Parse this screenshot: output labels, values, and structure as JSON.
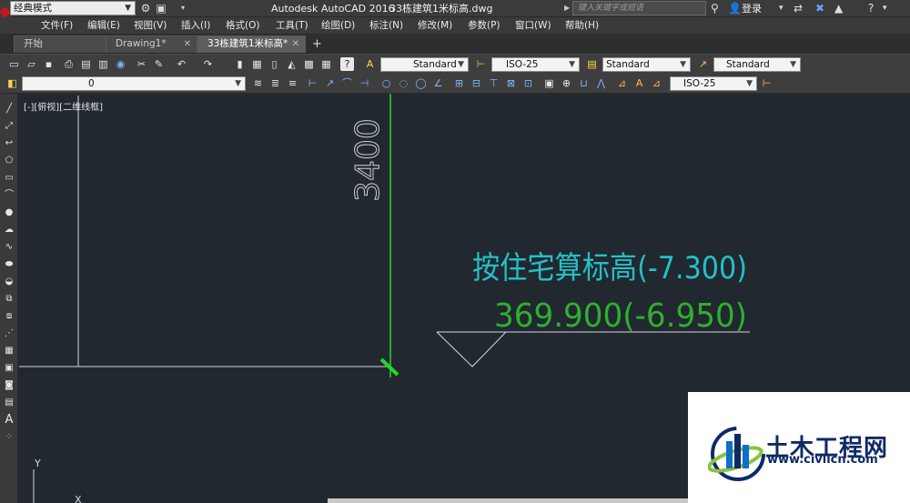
{
  "titlebar": {
    "workspace": "经典模式",
    "app_title": "Autodesk AutoCAD 2016",
    "file_name": "33栋建筑1米标高.dwg",
    "search_placeholder": "键入关键字或短语",
    "login": "登录"
  },
  "menu": [
    "文件(F)",
    "编辑(E)",
    "视图(V)",
    "插入(I)",
    "格式(O)",
    "工具(T)",
    "绘图(D)",
    "标注(N)",
    "修改(M)",
    "参数(P)",
    "窗口(W)",
    "帮助(H)"
  ],
  "tabs": [
    {
      "label": "开始",
      "active": false,
      "closable": false
    },
    {
      "label": "Drawing1*",
      "active": false,
      "closable": true
    },
    {
      "label": "33栋建筑1米标高*",
      "active": true,
      "closable": true
    }
  ],
  "styles": {
    "text_style": "Standard",
    "dim_style": "ISO-25",
    "table_style": "Standard",
    "mleader_style": "Standard"
  },
  "layer": {
    "current": "0"
  },
  "dimstyle_row2": "ISO-25",
  "viewport_label": "[-][俯视][二维线框]",
  "drawing": {
    "dimension_text": "3400",
    "annotation_line1": "按住宅算标高(-7.300)",
    "annotation_line2": "369.900(-6.950)",
    "ucs_y": "Y",
    "ucs_x": "X",
    "colors": {
      "background": "#212830",
      "white_lines": "#d8d8d8",
      "green_line": "#22d822",
      "cyan_text": "#23c1c6",
      "green_text": "#2fb02f"
    }
  },
  "watermark": {
    "title": "土木工程网",
    "url": "www.civilcn.com"
  }
}
